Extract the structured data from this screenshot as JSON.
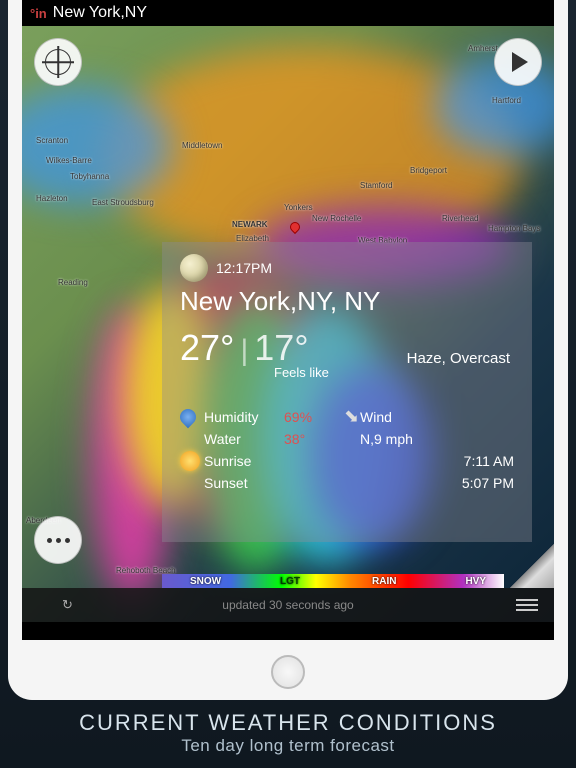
{
  "status": {
    "brand": "°in",
    "location": "New York,NY"
  },
  "buttons": {
    "locate": "locate",
    "play": "play",
    "more": "more"
  },
  "card": {
    "time": "12:17PM",
    "location": "New York,NY, NY",
    "temp": "27°",
    "feels_temp": "17°",
    "feels_label": "Feels like",
    "condition": "Haze, Overcast",
    "humidity_label": "Humidity",
    "humidity_value": "69%",
    "water_label": "Water",
    "water_value": "38°",
    "wind_label": "Wind",
    "wind_value": "N,9 mph",
    "sunrise_label": "Sunrise",
    "sunrise_value": "7:11 AM",
    "sunset_label": "Sunset",
    "sunset_value": "5:07 PM"
  },
  "legend": {
    "snow": "SNOW",
    "lgt": "LGT",
    "rain": "RAIN",
    "hvy": "HVY"
  },
  "footer": {
    "updated": "updated 30 seconds ago"
  },
  "map_labels": {
    "scranton": "Scranton",
    "wilkesbarre": "Wilkes-Barre",
    "hazleton": "Hazleton",
    "reading": "Reading",
    "newark": "NEWARK",
    "elizabeth": "Elizabeth",
    "stamford": "Stamford",
    "bridgeport": "Bridgeport",
    "hartford": "Hartford",
    "amherst": "Amherst",
    "yonkers": "Yonkers",
    "newrochelle": "New Rochelle",
    "hamptonbays": "Hampton Bays",
    "rehoboth": "Rehoboth Beach",
    "aberdeen": "Aberdeen",
    "middletown": "Middletown",
    "tobyhanna": "Tobyhanna",
    "eaststroudsburg": "East Stroudsburg",
    "westbabylon": "West Babylon",
    "riverhead": "Riverhead"
  },
  "caption": {
    "main": "CURRENT WEATHER CONDITIONS",
    "sub": "Ten day long term forecast"
  }
}
